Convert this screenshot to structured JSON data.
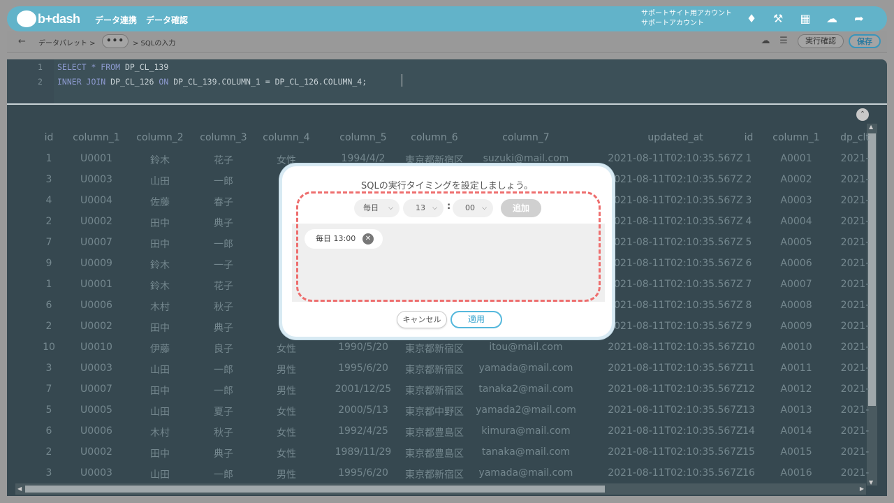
{
  "header": {
    "logo": "b+dash",
    "nav": [
      "データ連携",
      "データ確認"
    ],
    "account_line1": "サポートサイト用アカウント",
    "account_line2": "サポートアカウント",
    "icons": [
      "bell-icon",
      "wrench-icon",
      "grid-icon",
      "support-chat-icon",
      "logout-icon"
    ]
  },
  "subbar": {
    "back_glyph": "←",
    "crumb1": "データパレット >",
    "dots": "•••",
    "crumb2": "> SQLの入力",
    "run_check": "実行確認",
    "save": "保存"
  },
  "editor": {
    "line1_no": "1",
    "line2_no": "2",
    "line1_kw": "SELECT * FROM",
    "line1_rest": " DP_CL_139",
    "line2_kw1": "INNER JOIN",
    "line2_mid": " DP_CL_126 ",
    "line2_kw2": "ON",
    "line2_rest": " DP_CL_139.COLUMN_1 = DP_CL_126.COLUMN_4;"
  },
  "table": {
    "headers": [
      "id",
      "column_1",
      "column_2",
      "column_3",
      "column_4",
      "column_5",
      "column_6",
      "column_7",
      "updated_at",
      "id",
      "column_1",
      "dp_clt"
    ],
    "rows": [
      [
        "1",
        "U0001",
        "鈴木",
        "花子",
        "女性",
        "1994/4/2",
        "東京都新宿区",
        "suzuki@mail.com",
        "2021-08-11T02:10:35.567Z",
        "1",
        "A0001",
        "2021-"
      ],
      [
        "3",
        "U0003",
        "山田",
        "一郎",
        "",
        "",
        "",
        "",
        "2021-08-11T02:10:35.567Z",
        "2",
        "A0002",
        "2021-"
      ],
      [
        "4",
        "U0004",
        "佐藤",
        "春子",
        "",
        "",
        "",
        "",
        "2021-08-11T02:10:35.567Z",
        "3",
        "A0003",
        "2021-"
      ],
      [
        "2",
        "U0002",
        "田中",
        "典子",
        "",
        "",
        "",
        "",
        "2021-08-11T02:10:35.567Z",
        "4",
        "A0004",
        "2021-"
      ],
      [
        "7",
        "U0007",
        "田中",
        "一郎",
        "",
        "",
        "",
        "",
        "2021-08-11T02:10:35.567Z",
        "5",
        "A0005",
        "2021-"
      ],
      [
        "9",
        "U0009",
        "鈴木",
        "一子",
        "",
        "",
        "",
        "",
        "2021-08-11T02:10:35.567Z",
        "6",
        "A0006",
        "2021-"
      ],
      [
        "1",
        "U0001",
        "鈴木",
        "花子",
        "",
        "",
        "",
        "",
        "2021-08-11T02:10:35.567Z",
        "7",
        "A0007",
        "2021-"
      ],
      [
        "6",
        "U0006",
        "木村",
        "秋子",
        "",
        "",
        "",
        "",
        "2021-08-11T02:10:35.567Z",
        "8",
        "A0008",
        "2021-"
      ],
      [
        "2",
        "U0002",
        "田中",
        "典子",
        "",
        "",
        "",
        "",
        "2021-08-11T02:10:35.567Z",
        "9",
        "A0009",
        "2021-"
      ],
      [
        "10",
        "U0010",
        "伊藤",
        "良子",
        "女性",
        "1990/5/20",
        "東京都新宿区",
        "itou@mail.com",
        "2021-08-11T02:10:35.567Z",
        "10",
        "A0010",
        "2021-"
      ],
      [
        "3",
        "U0003",
        "山田",
        "一郎",
        "男性",
        "1995/6/20",
        "東京都新宿区",
        "yamada@mail.com",
        "2021-08-11T02:10:35.567Z",
        "11",
        "A0011",
        "2021-"
      ],
      [
        "7",
        "U0007",
        "田中",
        "一郎",
        "男性",
        "2001/12/25",
        "東京都新宿区",
        "tanaka2@mail.com",
        "2021-08-11T02:10:35.567Z",
        "12",
        "A0012",
        "2021-"
      ],
      [
        "5",
        "U0005",
        "山田",
        "夏子",
        "女性",
        "2000/5/13",
        "東京都中野区",
        "yamada2@mail.com",
        "2021-08-11T02:10:35.567Z",
        "13",
        "A0013",
        "2021-"
      ],
      [
        "6",
        "U0006",
        "木村",
        "秋子",
        "女性",
        "1992/4/25",
        "東京都豊島区",
        "kimura@mail.com",
        "2021-08-11T02:10:35.567Z",
        "14",
        "A0014",
        "2021-"
      ],
      [
        "2",
        "U0002",
        "田中",
        "典子",
        "女性",
        "1989/11/29",
        "東京都豊島区",
        "tanaka@mail.com",
        "2021-08-11T02:10:35.567Z",
        "15",
        "A0015",
        "2021-"
      ],
      [
        "3",
        "U0003",
        "山田",
        "一郎",
        "男性",
        "1995/6/20",
        "東京都新宿区",
        "yamada@mail.com",
        "2021-08-11T02:10:35.567Z",
        "16",
        "A0016",
        "2021-"
      ]
    ]
  },
  "modal": {
    "title": "SQLの実行タイミングを設定しましょう。",
    "frequency": "毎日",
    "hour": "13",
    "colon": ":",
    "minute": "00",
    "add": "追加",
    "schedule": "毎日 13:00",
    "cancel": "キャンセル",
    "apply": "適用"
  }
}
